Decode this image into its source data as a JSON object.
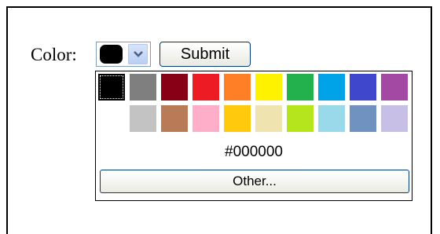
{
  "form": {
    "color_label": "Color:",
    "selected_color": "#000000",
    "submit_label": "Submit"
  },
  "picker": {
    "hex_value": "#000000",
    "other_label": "Other...",
    "palette_row1": [
      "#000000",
      "#7f7f7f",
      "#880015",
      "#ed1c24",
      "#ff7f27",
      "#fff200",
      "#22b14c",
      "#00a2e8",
      "#3f48cc",
      "#a349a4"
    ],
    "palette_row2": [
      "#ffffff",
      "#c3c3c3",
      "#b97a57",
      "#ffaec9",
      "#ffc90e",
      "#efe4b0",
      "#b5e61d",
      "#99d9ea",
      "#7092be",
      "#c8bfe7"
    ]
  }
}
